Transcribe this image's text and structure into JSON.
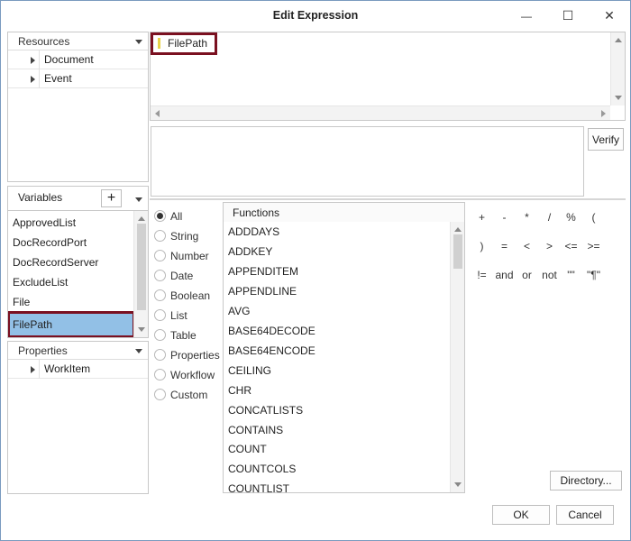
{
  "window": {
    "title": "Edit Expression",
    "minimize_symbol": "—",
    "maximize_symbol": "☐",
    "close_symbol": "✕"
  },
  "resources": {
    "header": "Resources",
    "items": [
      {
        "label": "Document"
      },
      {
        "label": "Event"
      }
    ]
  },
  "expression": {
    "text": "FilePath"
  },
  "verify_button": "Verify",
  "variables": {
    "header": "Variables",
    "add_symbol": "+",
    "items": [
      {
        "label": "ApprovedList"
      },
      {
        "label": "DocRecordPort"
      },
      {
        "label": "DocRecordServer"
      },
      {
        "label": "ExcludeList"
      },
      {
        "label": "File"
      },
      {
        "label": "FilePath",
        "selected": true
      }
    ]
  },
  "properties": {
    "header": "Properties",
    "items": [
      {
        "label": "WorkItem"
      }
    ]
  },
  "categories": {
    "selected": "All",
    "items": [
      "All",
      "String",
      "Number",
      "Date",
      "Boolean",
      "List",
      "Table",
      "Properties",
      "Workflow",
      "Custom"
    ]
  },
  "functions": {
    "header": "Functions",
    "items": [
      "ADDDAYS",
      "ADDKEY",
      "APPENDITEM",
      "APPENDLINE",
      "AVG",
      "BASE64DECODE",
      "BASE64ENCODE",
      "CEILING",
      "CHR",
      "CONCATLISTS",
      "CONTAINS",
      "COUNT",
      "COUNTCOLS",
      "COUNTLIST"
    ]
  },
  "operators": {
    "row1": [
      "+",
      "-",
      "*",
      "/",
      "%",
      "("
    ],
    "row2": [
      ")",
      "=",
      "<",
      ">",
      "<=",
      ">="
    ],
    "row3": [
      "!=",
      "and",
      "or",
      "not",
      "\"\"",
      "\"¶\""
    ]
  },
  "buttons": {
    "directory": "Directory...",
    "ok": "OK",
    "cancel": "Cancel"
  },
  "colors": {
    "selection_fill": "#92c0e6",
    "highlight_outline": "#7a1020",
    "window_border": "#7a9bbf"
  }
}
